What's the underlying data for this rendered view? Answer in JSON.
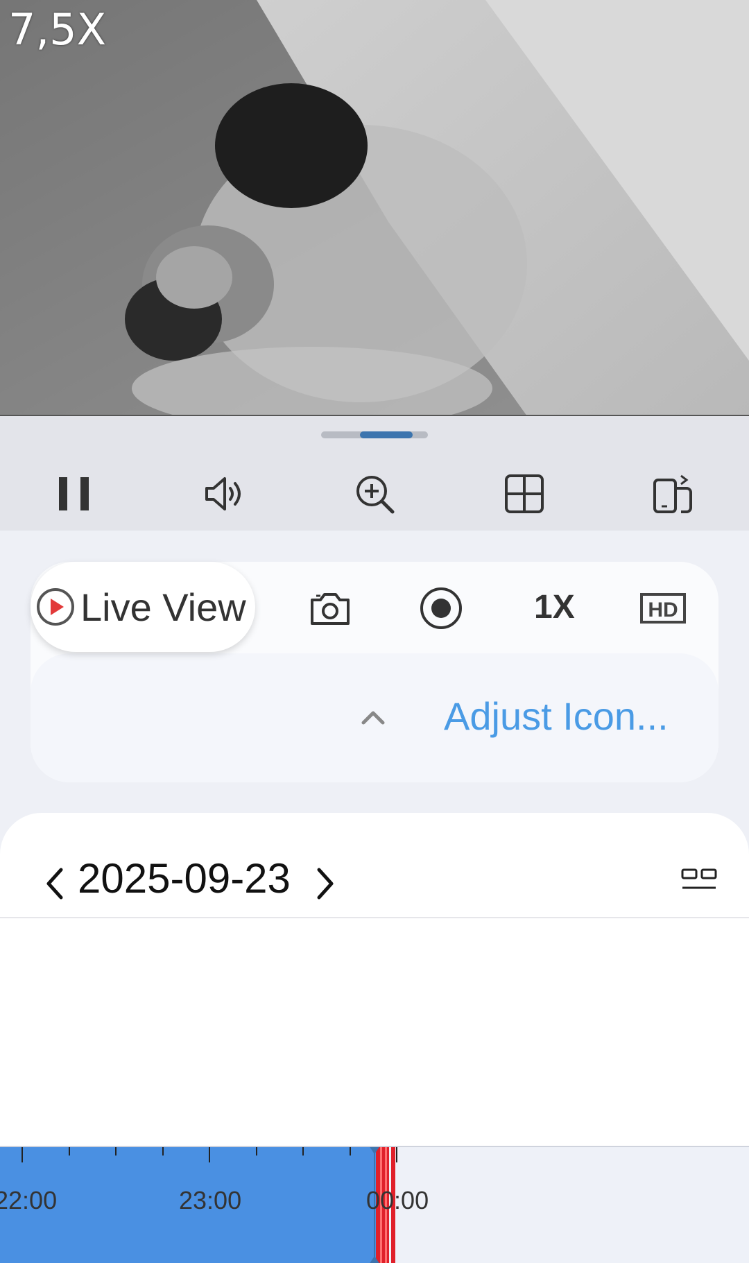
{
  "video": {
    "zoom_level": "7,5X"
  },
  "toolbar": {
    "icons": [
      "pause-icon",
      "speaker-icon",
      "zoom-in-icon",
      "grid-layout-icon",
      "rotate-screen-icon"
    ]
  },
  "controls": {
    "live_view_label": "Live View",
    "speed_label": "1X",
    "quality_label": "HD",
    "adjust_label": "Adjust Icon..."
  },
  "playback": {
    "date": "2025-09-23",
    "timeline_labels": [
      "22:00",
      "23:00",
      "00:00"
    ],
    "colors": {
      "recording": "#4a90e2",
      "event": "#e0202a",
      "background": "#eef1f8"
    }
  }
}
